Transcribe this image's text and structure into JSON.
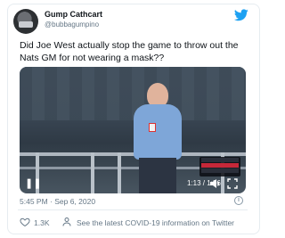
{
  "tweet": {
    "author_name": "Gump Cathcart",
    "author_handle": "@bubbagumpino",
    "text": "Did Joe West actually stop the game to throw out the Nats GM for not wearing a mask??",
    "datetime": "5:45 PM · Sep 6, 2020",
    "likes": "1.3K",
    "covid_link": "See the latest COVID-19 information on Twitter"
  },
  "video": {
    "time": "1:13 / 1:36",
    "icons": [
      "play-icon",
      "volume-icon",
      "fullscreen-icon"
    ]
  },
  "colors": {
    "brand": "#1da1f2",
    "muted": "#657786",
    "border": "#e6ecf0"
  }
}
